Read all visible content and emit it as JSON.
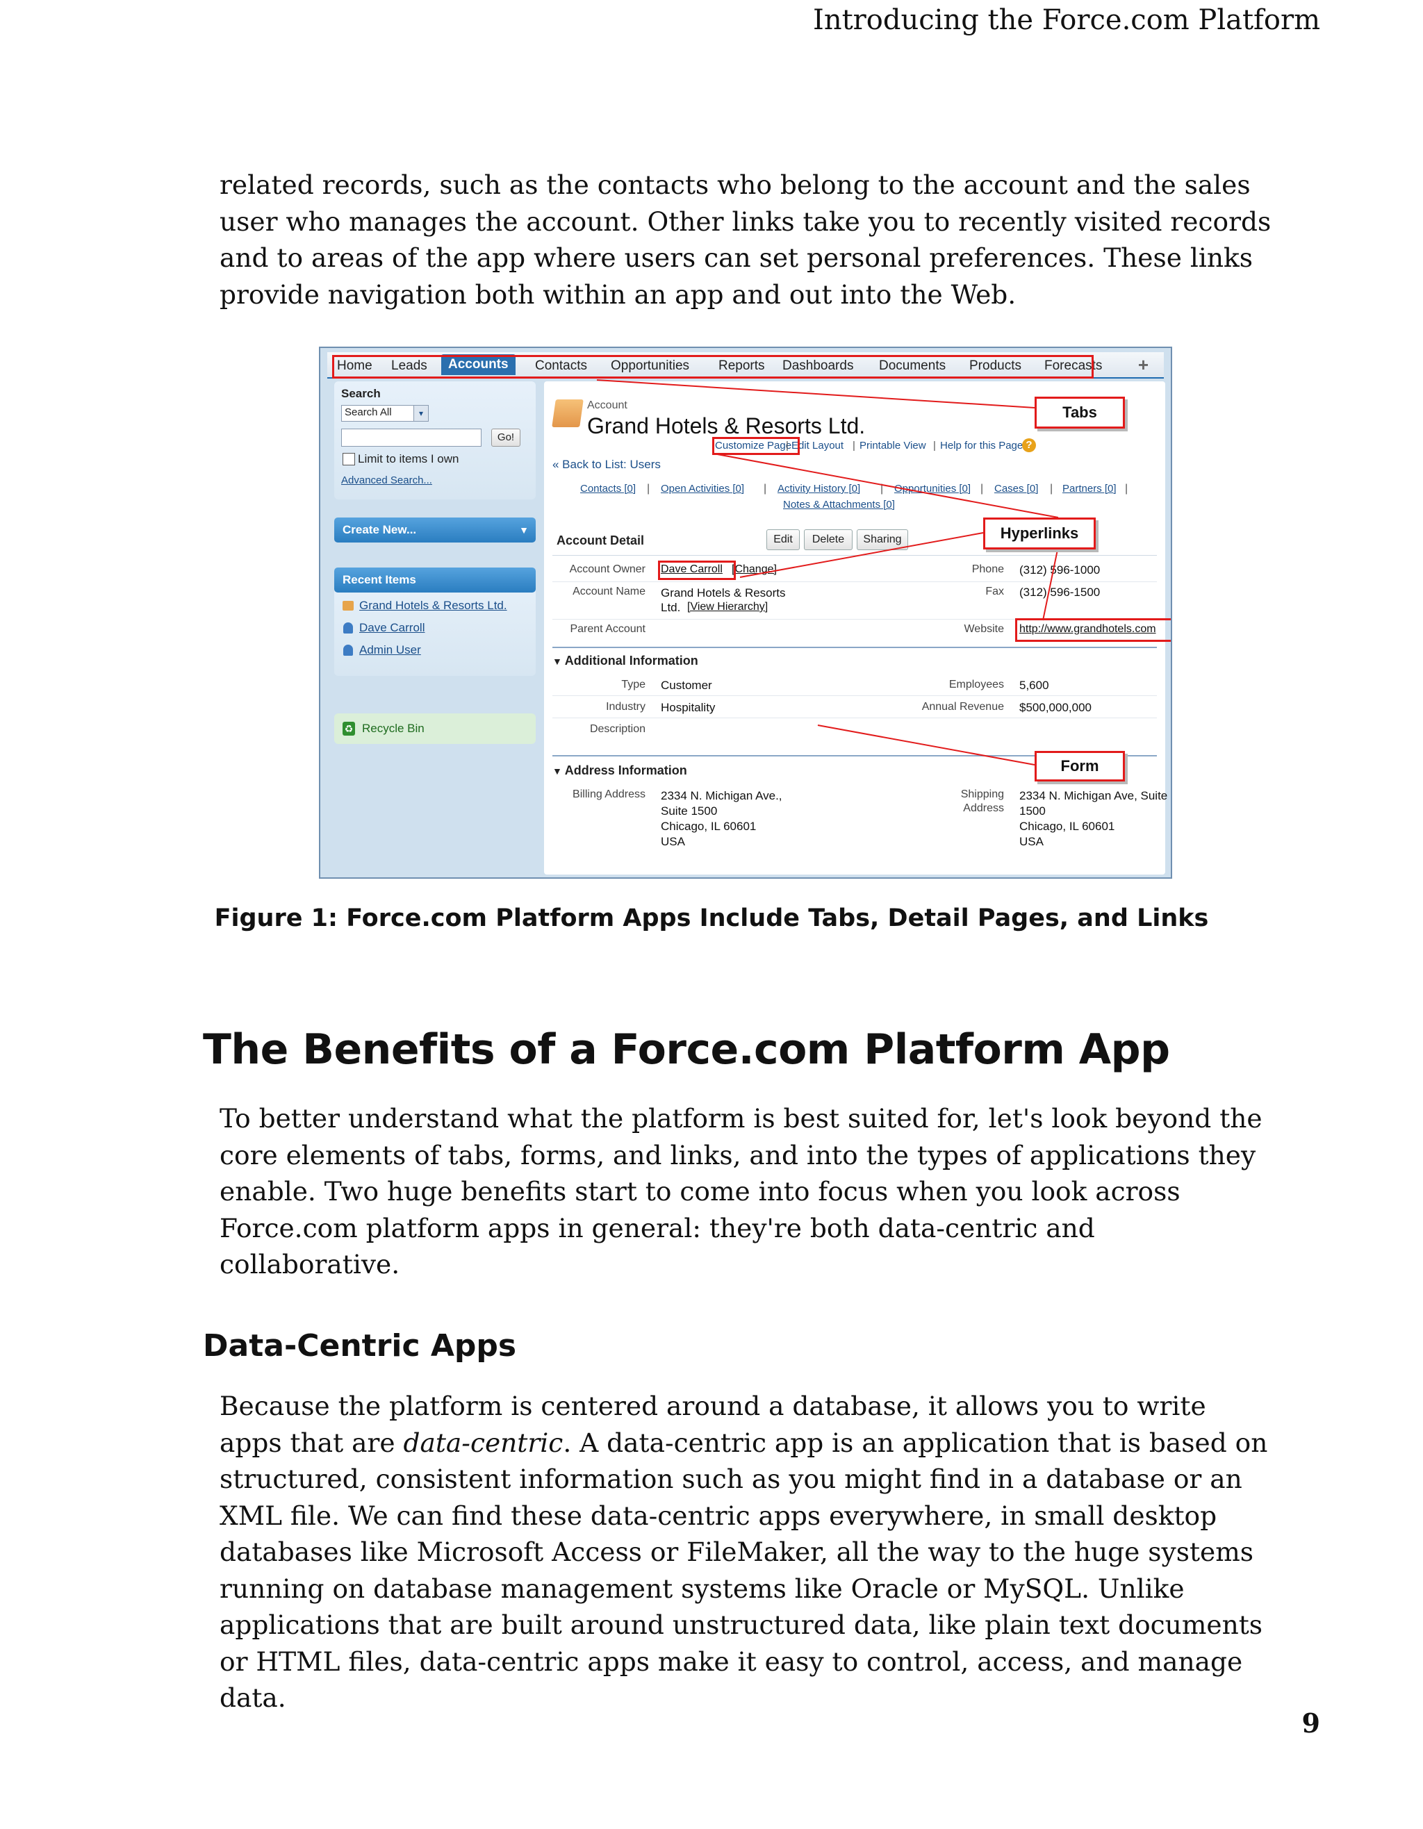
{
  "running_head": "Introducing the Force.com Platform",
  "paragraphs": {
    "intro": "related records, such as the contacts who belong to the account and the sales user who manages the account. Other links take you to recently visited records and to areas of the app where users can set personal preferences. These links provide navigation both within an app and out into the Web.",
    "benefits": "To better understand what the platform is best suited for, let's look beyond the core elements of tabs, forms, and links, and into the types of applications they enable. Two huge benefits start to come into focus when you look across Force.com platform apps in general: they're both data-centric and collaborative.",
    "datacentric_before": "Because the platform is centered around a database, it allows you to write apps that are ",
    "datacentric_em": "data-centric",
    "datacentric_after": ". A data-centric app is an application that is based on structured, consistent information such as you might find in a database or an XML file. We can find these data-centric apps everywhere, in small desktop databases like Microsoft Access or FileMaker, all the way to the huge systems running on database management systems like Oracle or MySQL. Unlike applications that are built around unstructured data, like plain text documents or HTML files, data-centric apps make it easy to control, access, and manage data."
  },
  "headings": {
    "section": "The Benefits of a Force.com Platform App",
    "subsection": "Data-Centric Apps"
  },
  "figure_caption": "Figure 1: Force.com Platform Apps Include Tabs, Detail Pages, and Links",
  "page_number": "9",
  "screenshot": {
    "tabs": [
      "Home",
      "Leads",
      "Accounts",
      "Contacts",
      "Opportunities",
      "Reports",
      "Dashboards",
      "Documents",
      "Products",
      "Forecasts"
    ],
    "active_tab": "Accounts",
    "plus_icon": "+",
    "sidebar": {
      "search_title": "Search",
      "search_scope": "Search All",
      "go_button": "Go!",
      "limit_label": "Limit to items I own",
      "advanced_search": "Advanced Search...",
      "create_new": "Create New...",
      "recent_items_title": "Recent Items",
      "recent_items": [
        "Grand Hotels & Resorts Ltd.",
        "Dave Carroll",
        "Admin User"
      ],
      "recycle_bin": "Recycle Bin"
    },
    "header": {
      "object_label": "Account",
      "record_name": "Grand Hotels & Resorts Ltd.",
      "links": [
        "Customize Page",
        "Edit Layout",
        "Printable View",
        "Help for this Page"
      ],
      "back_link": "« Back to List: Users"
    },
    "related_links_row1": [
      "Contacts [0]",
      "Open Activities [0]",
      "Activity History [0]",
      "Opportunities [0]",
      "Cases [0]",
      "Partners [0]"
    ],
    "related_links_row2": [
      "Notes & Attachments [0]"
    ],
    "detail": {
      "title": "Account Detail",
      "buttons": [
        "Edit",
        "Delete",
        "Sharing"
      ],
      "account_owner_label": "Account Owner",
      "account_owner_value": "Dave Carroll",
      "change_link": "[Change]",
      "phone_label": "Phone",
      "phone_value": "(312) 596-1000",
      "account_name_label": "Account Name",
      "account_name_value_1": "Grand Hotels & Resorts",
      "account_name_value_2": "Ltd.",
      "view_hierarchy": "[View Hierarchy]",
      "fax_label": "Fax",
      "fax_value": "(312) 596-1500",
      "parent_account_label": "Parent Account",
      "website_label": "Website",
      "website_value": "http://www.grandhotels.com"
    },
    "additional": {
      "title": "Additional Information",
      "type_label": "Type",
      "type_value": "Customer",
      "employees_label": "Employees",
      "employees_value": "5,600",
      "industry_label": "Industry",
      "industry_value": "Hospitality",
      "revenue_label": "Annual Revenue",
      "revenue_value": "$500,000,000",
      "description_label": "Description"
    },
    "address": {
      "title": "Address Information",
      "billing_label": "Billing Address",
      "billing_lines": [
        "2334 N. Michigan Ave.,",
        "Suite 1500",
        "Chicago, IL 60601",
        "USA"
      ],
      "shipping_label_1": "Shipping",
      "shipping_label_2": "Address",
      "shipping_lines": [
        "2334 N. Michigan Ave, Suite",
        "1500",
        "Chicago, IL 60601",
        "USA"
      ]
    },
    "callouts": {
      "tabs": "Tabs",
      "hyperlinks": "Hyperlinks",
      "form": "Form"
    },
    "colors": {
      "callout_red": "#e21b1b",
      "active_tab_blue": "#2a6fae",
      "link_blue": "#1b4f8a"
    }
  }
}
